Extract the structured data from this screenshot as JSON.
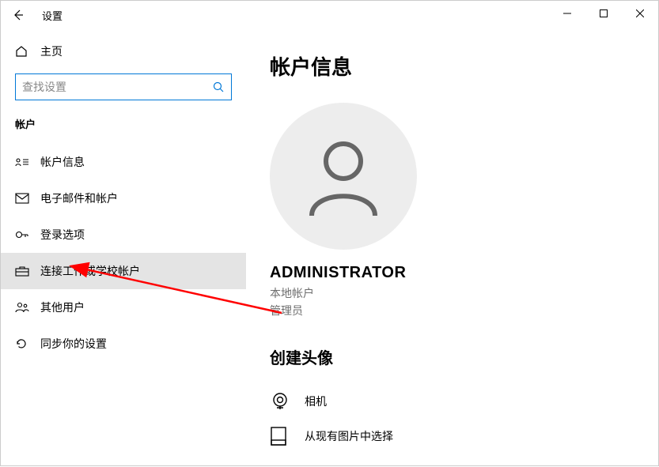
{
  "window": {
    "title": "设置"
  },
  "sidebar": {
    "home": "主页",
    "search_placeholder": "查找设置",
    "section": "帐户",
    "items": [
      {
        "label": "帐户信息"
      },
      {
        "label": "电子邮件和帐户"
      },
      {
        "label": "登录选项"
      },
      {
        "label": "连接工作或学校帐户"
      },
      {
        "label": "其他用户"
      },
      {
        "label": "同步你的设置"
      }
    ]
  },
  "main": {
    "title": "帐户信息",
    "username": "ADMINISTRATOR",
    "account_type": "本地帐户",
    "role": "管理员",
    "create_avatar_heading": "创建头像",
    "options": [
      {
        "label": "相机"
      },
      {
        "label": "从现有图片中选择"
      }
    ]
  }
}
